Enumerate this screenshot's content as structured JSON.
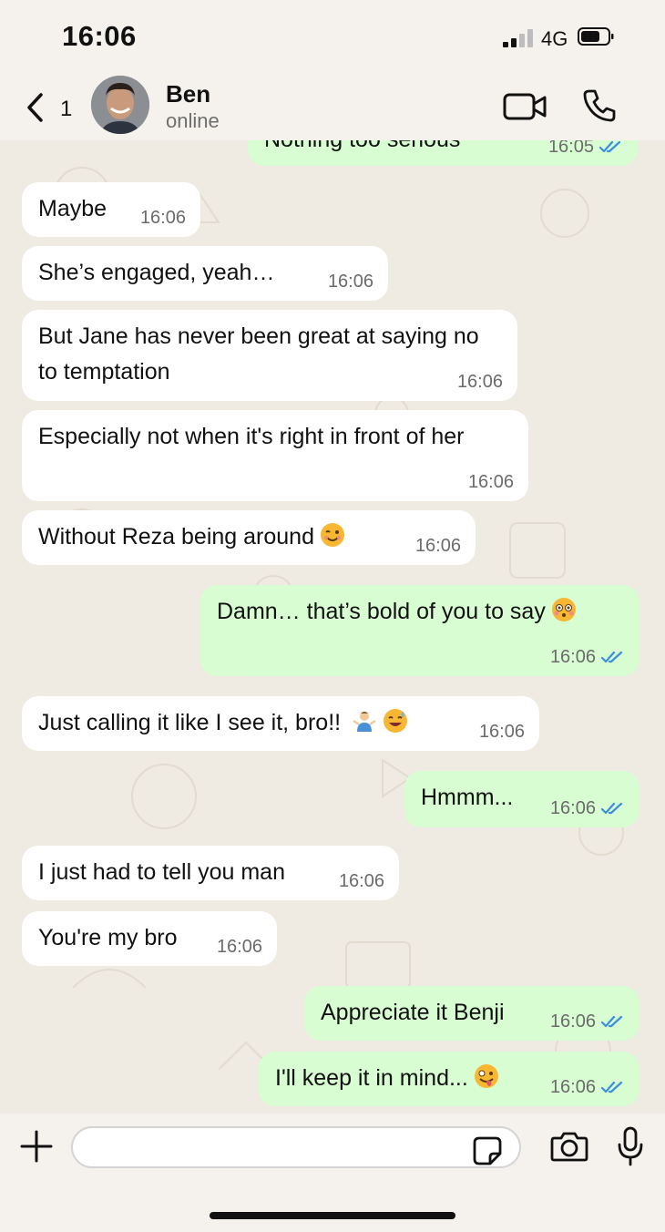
{
  "status_bar": {
    "time": "16:06",
    "network": "4G"
  },
  "header": {
    "back_count": "1",
    "contact_name": "Ben",
    "contact_status": "online"
  },
  "composer": {
    "placeholder": ""
  },
  "messages": [
    {
      "text": "Nothing too serious",
      "time": "16:05",
      "dir": "out",
      "read": true
    },
    {
      "text": "Maybe",
      "time": "16:06",
      "dir": "in"
    },
    {
      "text": "She’s engaged, yeah…",
      "time": "16:06",
      "dir": "in"
    },
    {
      "text": "But Jane has never been great at saying no to temptation",
      "time": "16:06",
      "dir": "in"
    },
    {
      "text": "Especially not when it's right in front of her",
      "time": "16:06",
      "dir": "in"
    },
    {
      "text": "Without Reza being around",
      "time": "16:06",
      "dir": "in",
      "emoji": "winking-face"
    },
    {
      "text": "Damn… that’s bold of you to say",
      "time": "16:06",
      "dir": "out",
      "read": true,
      "emoji": "flushed-face"
    },
    {
      "text": "Just calling it like I see it, bro!!",
      "time": "16:06",
      "dir": "in",
      "emoji": "shrugging-person, grinning-sweat-face"
    },
    {
      "text": "Hmmm...",
      "time": "16:06",
      "dir": "out",
      "read": true
    },
    {
      "text": "I just had to tell you man",
      "time": "16:06",
      "dir": "in"
    },
    {
      "text": "You're my bro",
      "time": "16:06",
      "dir": "in"
    },
    {
      "text": "Appreciate it Benji",
      "time": "16:06",
      "dir": "out",
      "read": true
    },
    {
      "text": "I'll keep it in mind...",
      "time": "16:06",
      "dir": "out",
      "read": true,
      "emoji": "zany-face"
    }
  ],
  "colors": {
    "outgoing_bubble": "#d9fdd3",
    "incoming_bubble": "#ffffff",
    "read_ticks": "#3a8fdc",
    "chat_background": "#efeae2"
  }
}
